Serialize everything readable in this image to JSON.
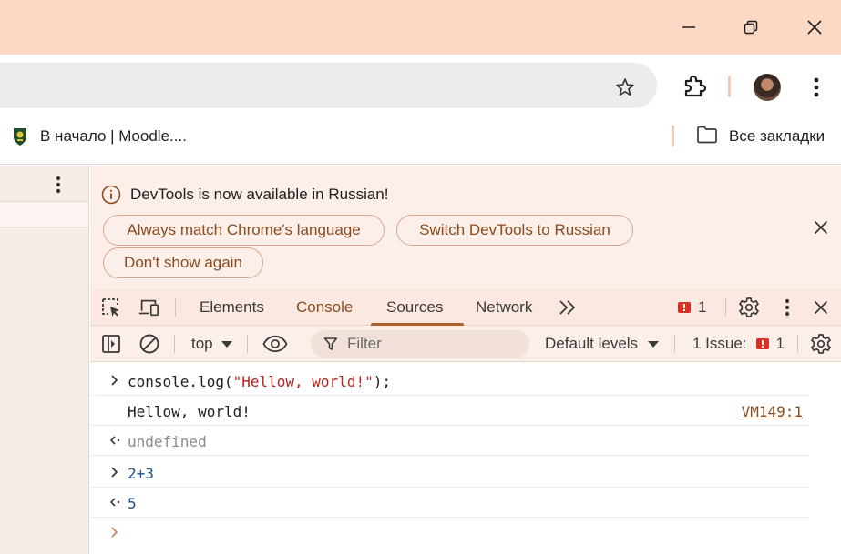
{
  "window": {
    "minimize_icon": "minimize-icon",
    "restore_icon": "restore-icon",
    "close_icon": "close-icon"
  },
  "toolbar": {
    "star_icon": "star-icon",
    "extensions_icon": "puzzle-icon",
    "menu_icon": "kebab-icon"
  },
  "bookmarks": {
    "item_label": "В начало | Moodle....",
    "all_label": "Все закладки"
  },
  "infobar": {
    "message": "DevTools is now available in Russian!",
    "buttons": {
      "match": "Always match Chrome's language",
      "switch": "Switch DevTools to Russian",
      "dont_show": "Don't show again"
    }
  },
  "devtools": {
    "tabs": [
      "Elements",
      "Console",
      "Sources",
      "Network"
    ],
    "active_tab": "Console",
    "issues_count": "1"
  },
  "console_toolbar": {
    "context": "top",
    "filter_placeholder": "Filter",
    "levels": "Default levels",
    "issues_label": "1 Issue:",
    "issues_count": "1"
  },
  "console": {
    "row1": {
      "prefix": "console.log(",
      "string": "\"Hellow, world!\"",
      "suffix": ");"
    },
    "row2": {
      "text": "Hellow, world!",
      "source": "VM149:1"
    },
    "row3": {
      "text": "undefined"
    },
    "row4": {
      "text": "2+3"
    },
    "row5": {
      "text": "5"
    }
  },
  "colors": {
    "titlebar": "#fbd9c4",
    "accent": "#a8602e",
    "error": "#d93025"
  }
}
